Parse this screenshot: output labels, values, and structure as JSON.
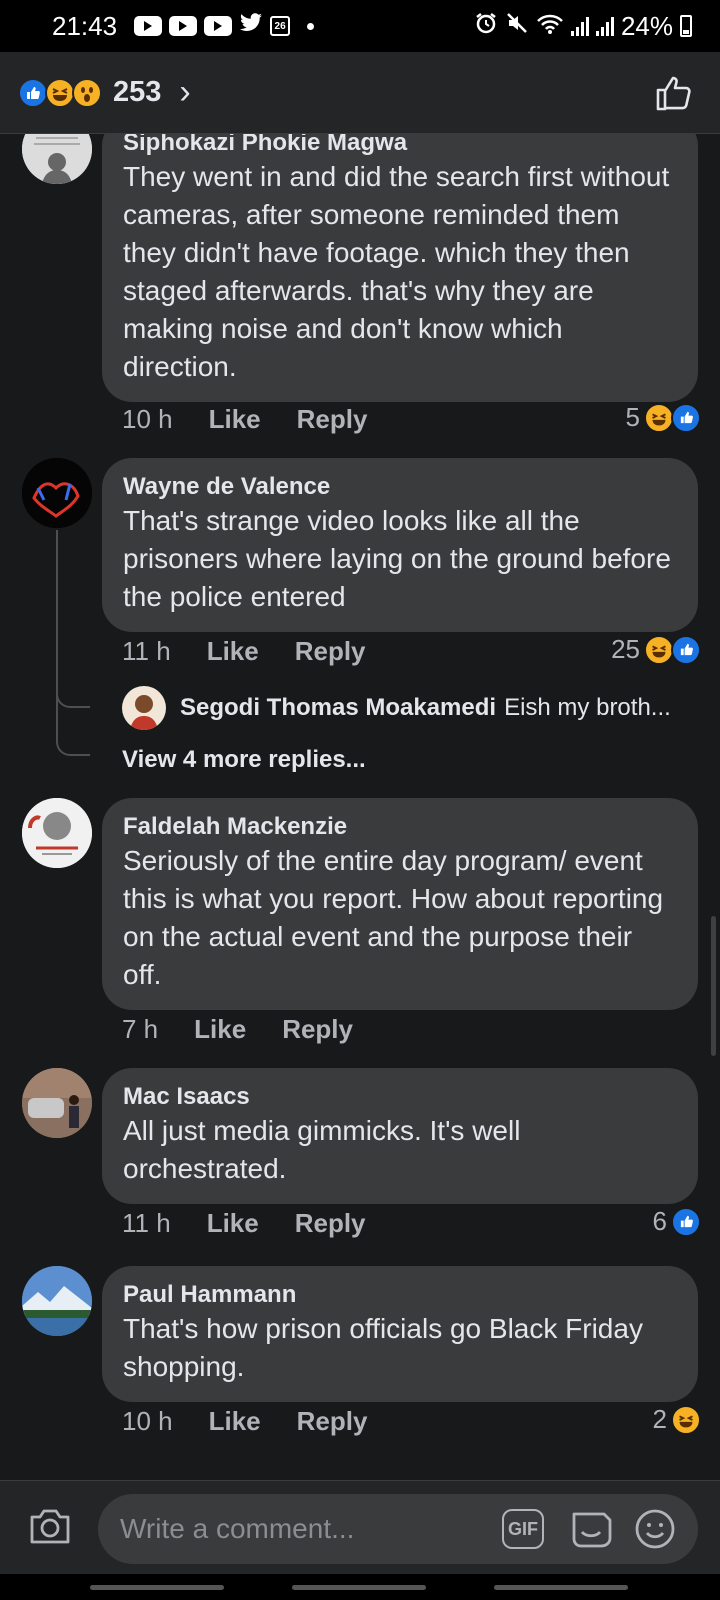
{
  "status_bar": {
    "time": "21:43",
    "calendar_day": "26",
    "battery": "24%"
  },
  "header": {
    "reaction_count": "253",
    "reactions": [
      "like",
      "haha",
      "wow"
    ]
  },
  "comments": [
    {
      "author": "Siphokazi Phokie Magwa",
      "text": "They went in and did the search first without cameras,  after someone reminded them they didn't have footage. which they then staged afterwards. that's why they are making noise and don't know which direction.",
      "time": "10 h",
      "like": "Like",
      "reply": "Reply",
      "reaction_count": "5",
      "reactions": [
        "haha",
        "like"
      ]
    },
    {
      "author": "Wayne de Valence",
      "text": "That's strange video looks like all the prisoners where laying on the ground before the police entered",
      "time": "11 h",
      "like": "Like",
      "reply": "Reply",
      "reaction_count": "25",
      "reactions": [
        "haha",
        "like"
      ],
      "reply_preview": {
        "author": "Segodi Thomas Moakamedi",
        "snippet": "Eish my broth..."
      },
      "view_more": "View 4 more replies..."
    },
    {
      "author": "Faldelah Mackenzie",
      "text": "Seriously of the entire day program/ event this is what you report. How about reporting on the actual event and the purpose their off.",
      "time": "7 h",
      "like": "Like",
      "reply": "Reply"
    },
    {
      "author": "Mac Isaacs",
      "text": "All just media gimmicks. It's well orchestrated.",
      "time": "11 h",
      "like": "Like",
      "reply": "Reply",
      "reaction_count": "6",
      "reactions": [
        "like"
      ]
    },
    {
      "author": "Paul Hammann",
      "text": "That's how prison officials go Black Friday shopping.",
      "time": "10 h",
      "like": "Like",
      "reply": "Reply",
      "reaction_count": "2",
      "reactions": [
        "haha"
      ]
    }
  ],
  "composer": {
    "placeholder": "Write a comment...",
    "gif_label": "GIF"
  },
  "colors": {
    "background": "#18191a",
    "bubble": "#3a3b3c",
    "like_blue": "#1b74e4",
    "haha_yellow": "#f7b125",
    "secondary_text": "#b0b3b8"
  }
}
